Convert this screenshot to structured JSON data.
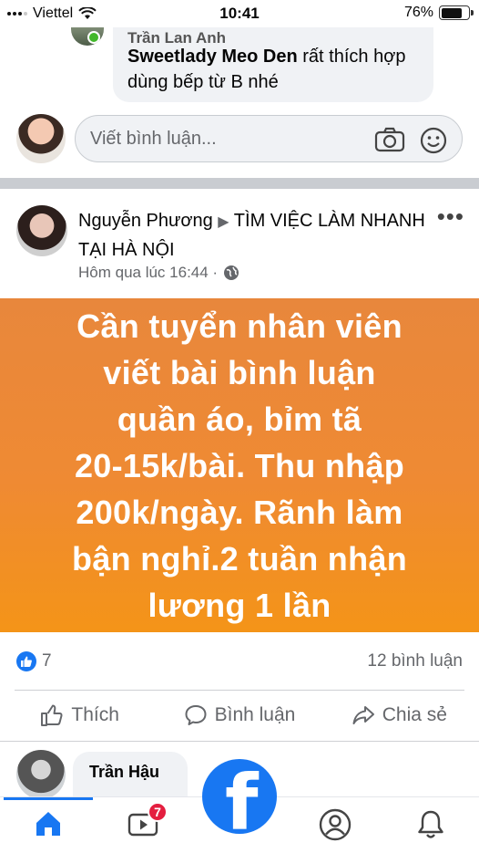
{
  "status_bar": {
    "carrier": "Viettel",
    "time": "10:41",
    "battery": "76%",
    "battery_level": 0.76
  },
  "previous_comment": {
    "author": "Trần Lan Anh",
    "tag": "Sweetlady Meo Den",
    "text": " rất thích hợp dùng bếp từ B nhé"
  },
  "composer": {
    "placeholder": "Viết bình luận...",
    "icons": [
      "camera-icon",
      "smiley-icon"
    ]
  },
  "post": {
    "author": "Nguyễn Phương",
    "arrow": "▶",
    "group": "TÌM VIỆC LÀM NHANH TẠI HÀ NỘI",
    "timestamp": "Hôm qua lúc 16:44 ·",
    "privacy_icon": "globe-icon",
    "more": "•••",
    "banner_text": "Cần tuyển nhân viên\nviết bài bình luận\nquần áo, bỉm tã\n20-15k/bài. Thu nhập\n200k/ngày. Rãnh làm\nbận nghỉ.2 tuần nhận\nlương 1 lần",
    "banner_colors": [
      "#e8873c",
      "#f49418"
    ],
    "like_count": "7",
    "comment_count": "12 bình luận",
    "actions": {
      "like": "Thích",
      "comment": "Bình luận",
      "share": "Chia sẻ"
    }
  },
  "next_comment": {
    "author": "Trần Hậu"
  },
  "tabbar": {
    "tabs": [
      "home-icon",
      "watch-icon",
      "profile-icon",
      "notifications-icon"
    ],
    "watch_badge": "7",
    "accent": "#1877f2"
  }
}
